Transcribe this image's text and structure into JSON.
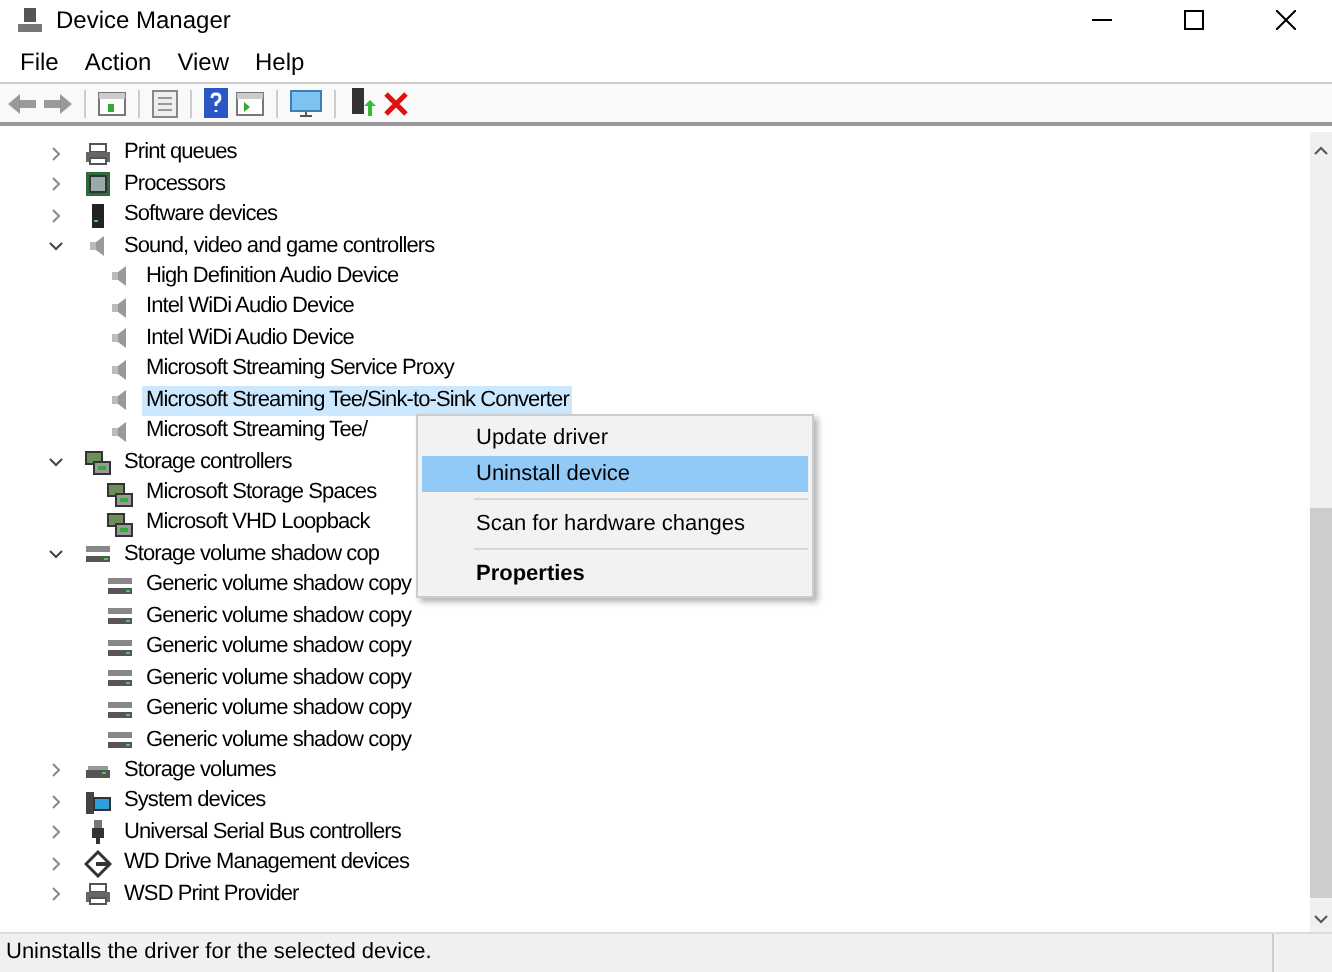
{
  "window": {
    "title": "Device Manager"
  },
  "menu_bar": [
    "File",
    "Action",
    "View",
    "Help"
  ],
  "tree": [
    {
      "label": "Print queues",
      "kind": "printer",
      "expanded": false,
      "selected": false
    },
    {
      "label": "Processors",
      "kind": "chip",
      "expanded": false,
      "selected": false
    },
    {
      "label": "Software devices",
      "kind": "tower",
      "expanded": false,
      "selected": false
    },
    {
      "label": "Sound, video and game controllers",
      "kind": "speaker",
      "expanded": true,
      "selected": false,
      "children": [
        {
          "label": "High Definition Audio Device",
          "kind": "speaker",
          "selected": false
        },
        {
          "label": "Intel WiDi Audio Device",
          "kind": "speaker",
          "selected": false
        },
        {
          "label": "Intel WiDi Audio Device",
          "kind": "speaker",
          "selected": false
        },
        {
          "label": "Microsoft Streaming Service Proxy",
          "kind": "speaker",
          "selected": false
        },
        {
          "label": "Microsoft Streaming Tee/Sink-to-Sink Converter",
          "kind": "speaker",
          "selected": true
        },
        {
          "label": "Microsoft Streaming Tee/",
          "kind": "speaker",
          "selected": false
        }
      ]
    },
    {
      "label": "Storage controllers",
      "kind": "storage",
      "expanded": true,
      "selected": false,
      "children": [
        {
          "label": "Microsoft Storage Spaces",
          "kind": "storage",
          "selected": false
        },
        {
          "label": "Microsoft VHD Loopback",
          "kind": "storage",
          "selected": false
        }
      ]
    },
    {
      "label": "Storage volume shadow cop",
      "kind": "disk",
      "expanded": true,
      "selected": false,
      "children": [
        {
          "label": "Generic volume shadow copy",
          "kind": "disk",
          "selected": false
        },
        {
          "label": "Generic volume shadow copy",
          "kind": "disk",
          "selected": false
        },
        {
          "label": "Generic volume shadow copy",
          "kind": "disk",
          "selected": false
        },
        {
          "label": "Generic volume shadow copy",
          "kind": "disk",
          "selected": false
        },
        {
          "label": "Generic volume shadow copy",
          "kind": "disk",
          "selected": false
        },
        {
          "label": "Generic volume shadow copy",
          "kind": "disk",
          "selected": false
        }
      ]
    },
    {
      "label": "Storage volumes",
      "kind": "volume",
      "expanded": false,
      "selected": false
    },
    {
      "label": "System devices",
      "kind": "system",
      "expanded": false,
      "selected": false
    },
    {
      "label": "Universal Serial Bus controllers",
      "kind": "usb",
      "expanded": false,
      "selected": false
    },
    {
      "label": "WD Drive Management devices",
      "kind": "wd",
      "expanded": false,
      "selected": false
    },
    {
      "label": "WSD Print Provider",
      "kind": "printer",
      "expanded": false,
      "selected": false
    }
  ],
  "context_menu": [
    {
      "label": "Update driver",
      "kind": "item",
      "selected": false
    },
    {
      "label": "Uninstall device",
      "kind": "item",
      "selected": true
    },
    {
      "kind": "separator"
    },
    {
      "label": "Scan for hardware changes",
      "kind": "item",
      "selected": false
    },
    {
      "kind": "separator"
    },
    {
      "label": "Properties",
      "kind": "default",
      "selected": false
    }
  ],
  "status_bar": "Uninstalls the driver for the selected device."
}
